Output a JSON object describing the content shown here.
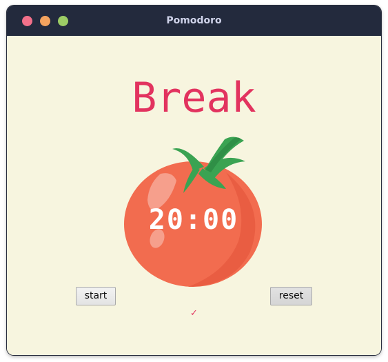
{
  "window": {
    "title": "Pomodoro",
    "controls": {
      "close_color": "#f2708a",
      "minimize_color": "#f4a35f",
      "maximize_color": "#9ccc65"
    }
  },
  "app": {
    "heading": "Break",
    "timer": "20:00",
    "start_label": "start",
    "reset_label": "reset",
    "checkmarks": "✓"
  },
  "colors": {
    "background": "#f7f5df",
    "accent": "#e2335f",
    "tomato": "#f26c4f",
    "leaf": "#3aa352"
  },
  "icons": {
    "tomato": "tomato-icon"
  }
}
